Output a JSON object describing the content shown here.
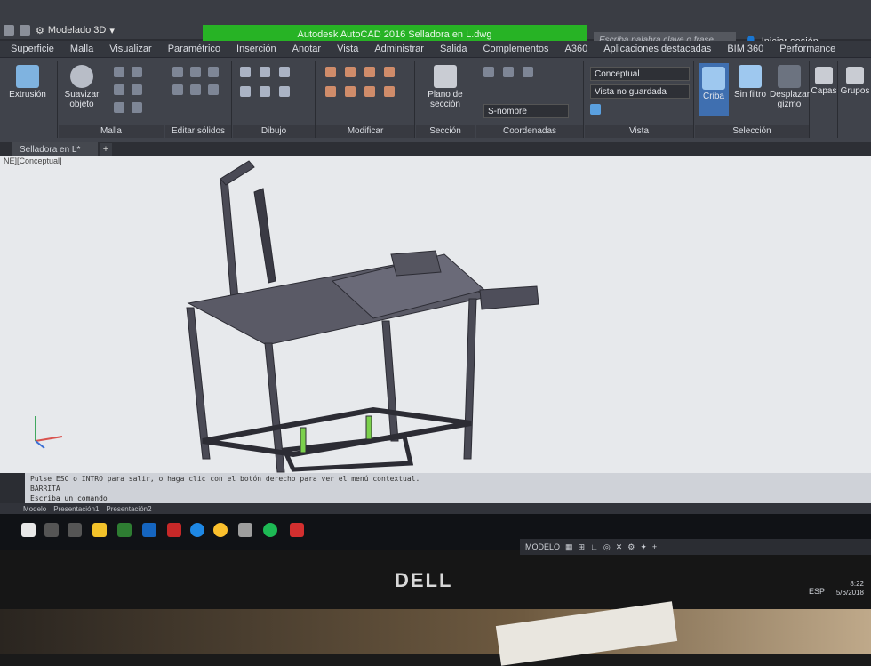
{
  "window": {
    "workspace": "Modelado 3D",
    "title": "Autodesk AutoCAD 2016   Selladora en L.dwg",
    "search_placeholder": "Escriba palabra clave o frase",
    "signin": "Iniciar sesión"
  },
  "tabs": [
    "Superficie",
    "Malla",
    "Visualizar",
    "Paramétrico",
    "Inserción",
    "Anotar",
    "Vista",
    "Administrar",
    "Salida",
    "Complementos",
    "A360",
    "Aplicaciones destacadas",
    "BIM 360",
    "Performance"
  ],
  "ribbon": {
    "extrusion": "Extrusión",
    "suavizar": "Suavizar objeto",
    "panels": {
      "malla": "Malla",
      "editar_solidos": "Editar sólidos",
      "dibujo": "Dibujo",
      "modificar": "Modificar",
      "seccion": "Sección",
      "coordenadas": "Coordenadas",
      "vista": "Vista",
      "seleccion": "Selección"
    },
    "plano_seccion": "Plano de sección",
    "visual_style": "Conceptual",
    "named_view": "Vista no guardada",
    "ucs": "S-nombre",
    "criba": "Criba",
    "sin_filtro": "Sin filtro",
    "gizmo": "Desplazar gizmo",
    "capas": "Capas",
    "grupos": "Grupos",
    "vista_btn": "Vista"
  },
  "doc": {
    "tab": "Selladora en L*",
    "viewport_label": "NE][Conceptual]"
  },
  "command": {
    "line1": "Pulse ESC o INTRO para salir, o haga clic con el botón derecho para ver el menú contextual.",
    "line2": "BARRITA",
    "line3": "Escriba un comando"
  },
  "layouts": [
    "Modelo",
    "Presentación1",
    "Presentación2"
  ],
  "status": {
    "mode": "MODELO"
  },
  "tray": {
    "lang": "ESP",
    "time": "8:22",
    "date": "5/6/2018"
  },
  "monitor_brand": "DELL"
}
